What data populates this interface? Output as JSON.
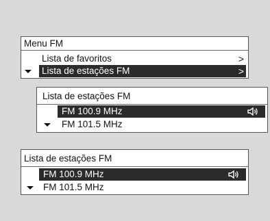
{
  "panel_menu": {
    "title": "Menu FM",
    "items": [
      {
        "label": "Lista de favoritos",
        "chevron": ">"
      },
      {
        "label": "Lista de estações FM",
        "chevron": ">",
        "selected": true
      }
    ]
  },
  "panel_list_a": {
    "title": "Lista de estações FM",
    "items": [
      {
        "label": "FM 100.9 MHz",
        "selected": true,
        "icon": "speaker-icon"
      },
      {
        "label": "FM 101.5 MHz"
      }
    ]
  },
  "panel_list_b": {
    "title": "Lista de estações FM",
    "items": [
      {
        "label": "FM 100.9 MHz",
        "selected": true,
        "icon": "speaker-icon"
      },
      {
        "label": "FM 101.5 MHz"
      }
    ]
  },
  "colors": {
    "background": "#d9d9d9",
    "panel": "#ffffff",
    "selected_row": "#2b2b2b",
    "selected_text": "#ffffff"
  }
}
